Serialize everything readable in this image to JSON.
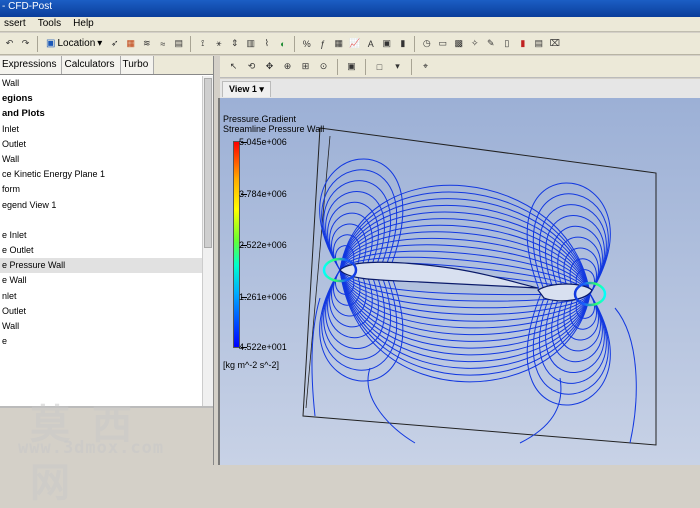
{
  "window": {
    "title": "- CFD-Post"
  },
  "menu": [
    "ssert",
    "Tools",
    "Help"
  ],
  "toolbar": {
    "location_label": "Location"
  },
  "left_panel": {
    "tabs": [
      "Expressions",
      "Calculators",
      "Turbo"
    ],
    "tree": [
      {
        "label": "Wall",
        "bold": false
      },
      {
        "label": "egions",
        "bold": true
      },
      {
        "label": "and Plots",
        "bold": true
      },
      {
        "label": "Inlet",
        "bold": false
      },
      {
        "label": "Outlet",
        "bold": false
      },
      {
        "label": "Wall",
        "bold": false
      },
      {
        "label": "ce Kinetic Energy Plane 1",
        "bold": false
      },
      {
        "label": "form",
        "bold": false
      },
      {
        "label": "egend View 1",
        "bold": false
      },
      {
        "label": "",
        "bold": false
      },
      {
        "label": "e Inlet",
        "bold": false
      },
      {
        "label": "e Outlet",
        "bold": false
      },
      {
        "label": "e Pressure Wall",
        "bold": false,
        "selected": true
      },
      {
        "label": "e Wall",
        "bold": false
      },
      {
        "label": "nlet",
        "bold": false
      },
      {
        "label": "Outlet",
        "bold": false
      },
      {
        "label": "Wall",
        "bold": false
      },
      {
        "label": "e",
        "bold": false
      }
    ]
  },
  "viewer": {
    "view_tab": "View 1",
    "legend": {
      "title_line1": "Pressure.Gradient",
      "title_line2": "Streamline Pressure Wall",
      "values": [
        "5.045e+006",
        "3.784e+006",
        "2.522e+006",
        "1.261e+006",
        "4.522e+001"
      ],
      "unit": "[kg m^-2 s^-2]"
    }
  },
  "watermark": {
    "cn": "莫西网",
    "url": "www.3dmox.com"
  },
  "colors": {
    "streamline": "#1238e0",
    "background_top": "#9cb0d6",
    "background_bottom": "#c8d2e6"
  }
}
